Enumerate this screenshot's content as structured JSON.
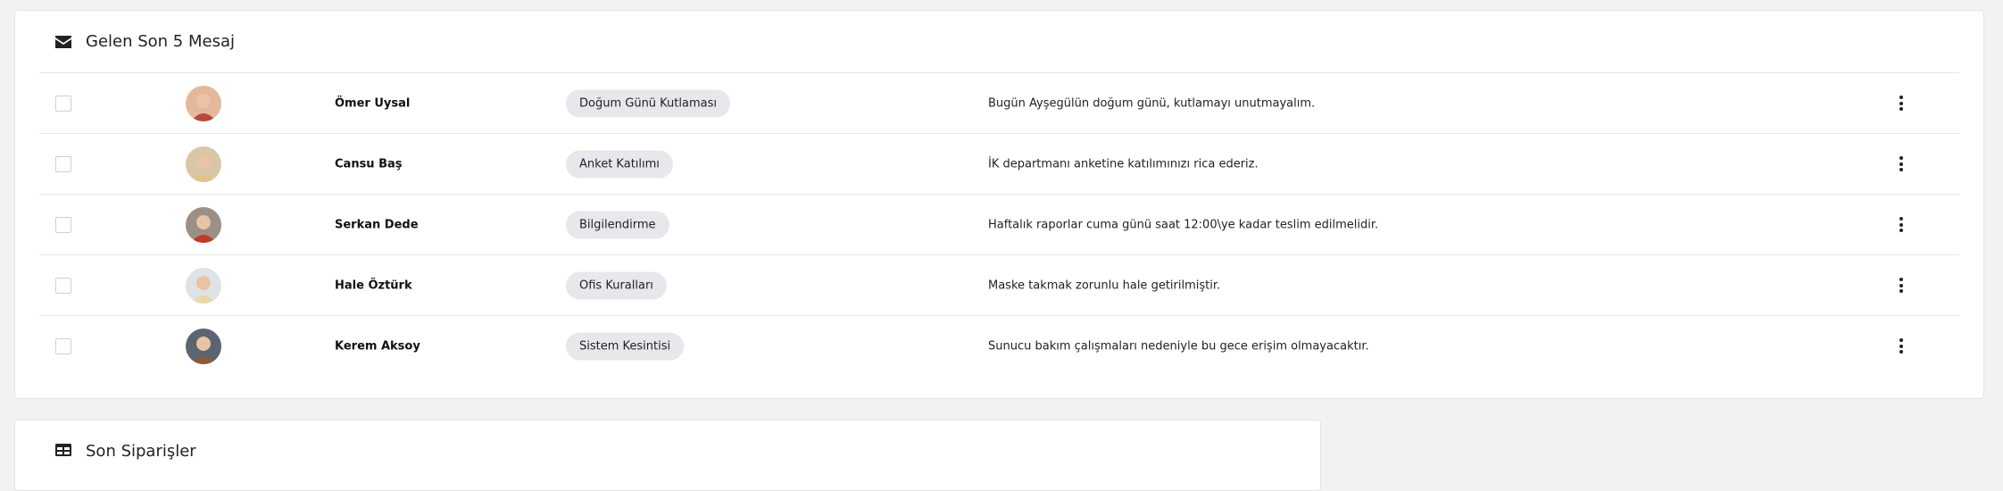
{
  "messages_card": {
    "title": "Gelen Son 5 Mesaj",
    "icon": "envelope-icon",
    "rows": [
      {
        "sender": "Ömer Uysal",
        "tag": "Doğum Günü Kutlaması",
        "text": "Bugün Ayşegülün doğum günü, kutlamayı unutmayalım.",
        "avatar_bg": "#e4b89a",
        "avatar_fg": "#b54a3c"
      },
      {
        "sender": "Cansu Baş",
        "tag": "Anket Katılımı",
        "text": "İK departmanı anketine katılımınızı rica ederiz.",
        "avatar_bg": "#d8c7a6",
        "avatar_fg": "#e3c38a"
      },
      {
        "sender": "Serkan Dede",
        "tag": "Bilgilendirme",
        "text": "Haftalık raporlar cuma günü saat 12:00\\ye kadar teslim edilmelidir.",
        "avatar_bg": "#9b8f86",
        "avatar_fg": "#c0392b"
      },
      {
        "sender": "Hale Öztürk",
        "tag": "Ofis Kuralları",
        "text": "Maske takmak zorunlu hale getirilmiştir.",
        "avatar_bg": "#dfe3e6",
        "avatar_fg": "#e7d9a8"
      },
      {
        "sender": "Kerem Aksoy",
        "tag": "Sistem Kesintisi",
        "text": "Sunucu bakım çalışmaları nedeniyle bu gece erişim olmayacaktır.",
        "avatar_bg": "#5b6470",
        "avatar_fg": "#8a5a3c"
      }
    ]
  },
  "orders_card": {
    "title": "Son Siparişler",
    "icon": "table-icon"
  }
}
